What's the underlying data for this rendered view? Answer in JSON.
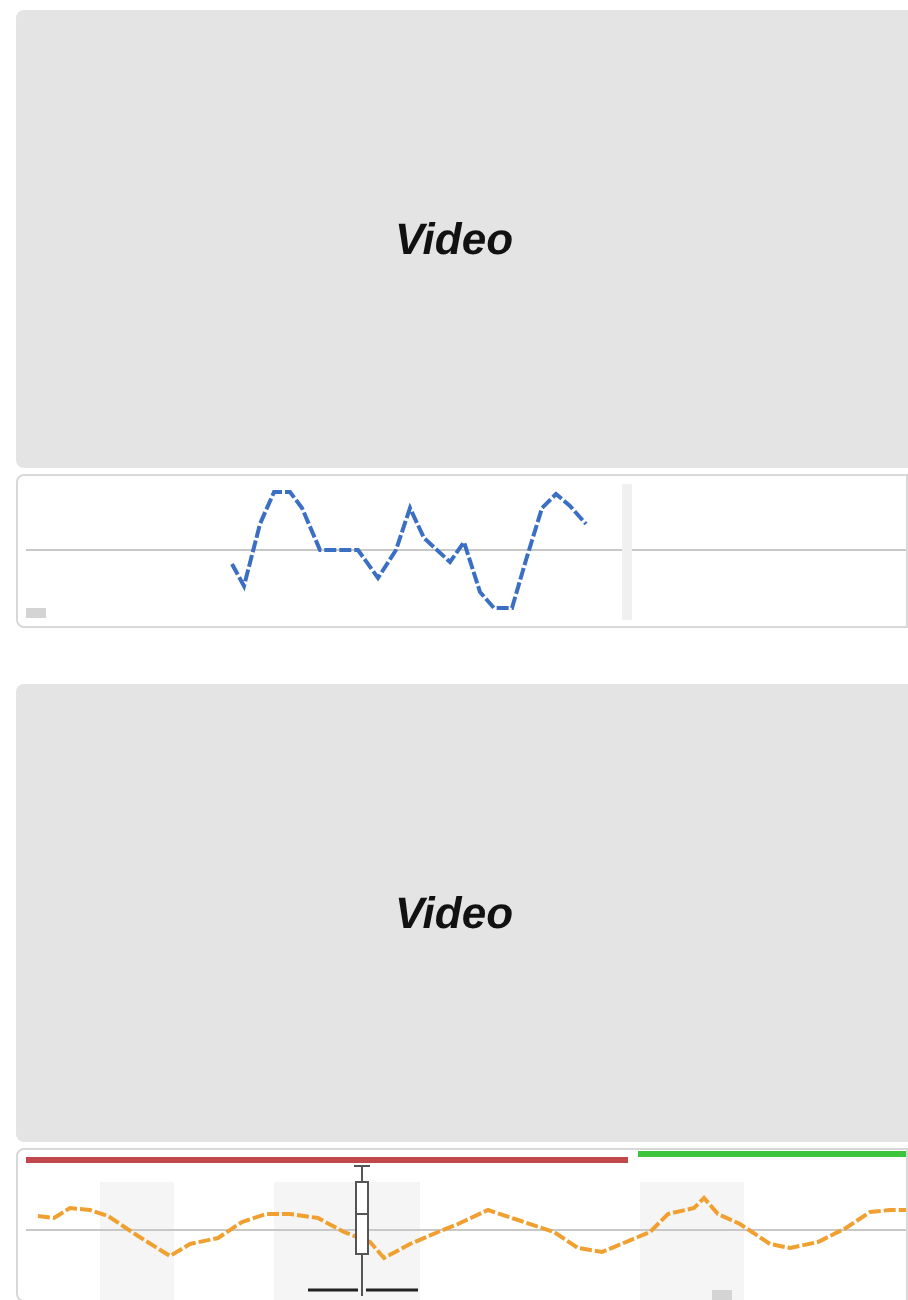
{
  "panels": [
    {
      "video_label": "Video",
      "kind": "sparkline"
    },
    {
      "video_label": "Video",
      "kind": "timeline"
    }
  ]
}
